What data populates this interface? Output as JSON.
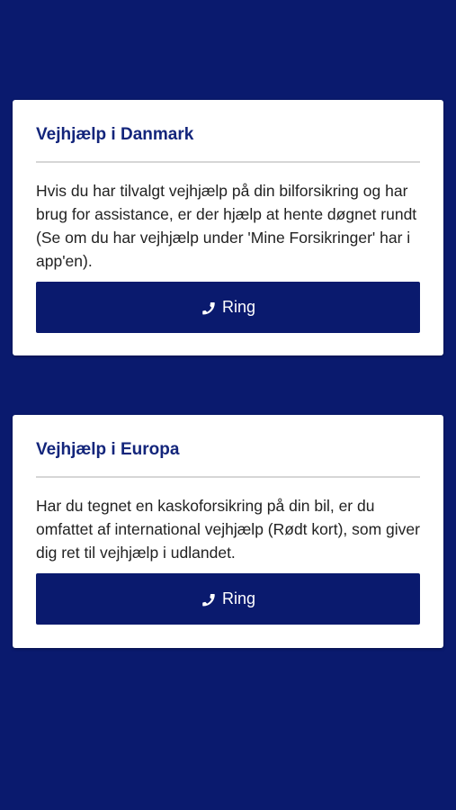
{
  "cards": [
    {
      "title": "Vejhjælp i Danmark",
      "text": "Hvis du har tilvalgt vejhjælp på din bilforsikring og har brug for assistance, er der hjælp at hente døgnet rundt (Se om du har vejhjælp under 'Mine Forsikringer' har i app'en).",
      "button_label": "Ring",
      "button_icon": "phone-icon"
    },
    {
      "title": "Vejhjælp i Europa",
      "text": "Har du tegnet en kaskoforsikring på din bil, er du omfattet af international vejhjælp (Rødt kort), som giver dig ret til vejhjælp i udlandet.",
      "button_label": "Ring",
      "button_icon": "phone-icon"
    }
  ],
  "colors": {
    "background": "#0a1a6e",
    "card": "#ffffff",
    "title": "#13257b",
    "button": "#0a1a6e",
    "button_text": "#ffffff"
  }
}
